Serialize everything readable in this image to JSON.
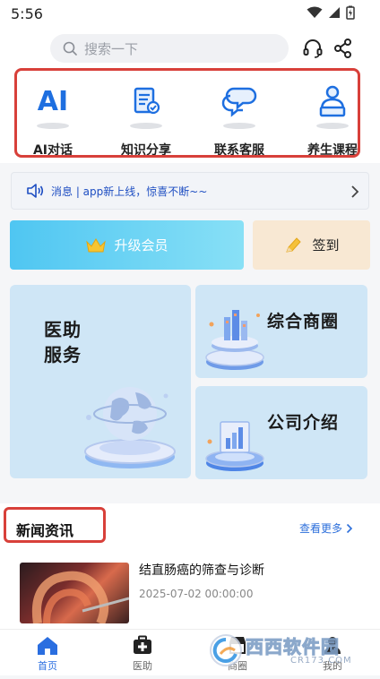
{
  "status_bar": {
    "time": "5:56"
  },
  "search": {
    "placeholder": "搜索一下"
  },
  "quick_actions": [
    {
      "label": "AI对话",
      "icon": "ai-icon",
      "icon_text": "AI"
    },
    {
      "label": "知识分享",
      "icon": "document-icon"
    },
    {
      "label": "联系客服",
      "icon": "chat-bubbles-icon"
    },
    {
      "label": "养生课程",
      "icon": "person-laptop-icon"
    }
  ],
  "notice": {
    "text": "消息 | app新上线，惊喜不断~~"
  },
  "vip": {
    "label": "升级会员"
  },
  "signin": {
    "label": "签到"
  },
  "cards": {
    "medical": {
      "line1": "医助",
      "line2": "服务"
    },
    "business": {
      "title": "综合商圈"
    },
    "company": {
      "title": "公司介绍"
    }
  },
  "news": {
    "section_title": "新闻资讯",
    "more_label": "查看更多",
    "items": [
      {
        "headline": "结直肠癌的筛查与诊断",
        "date": "2025-07-02 00:00:00"
      }
    ]
  },
  "tabs": [
    {
      "label": "首页",
      "icon": "home-icon",
      "active": true
    },
    {
      "label": "医助",
      "icon": "medical-kit-icon",
      "active": false
    },
    {
      "label": "商圈",
      "icon": "shop-icon",
      "active": false
    },
    {
      "label": "我的",
      "icon": "user-icon",
      "active": false
    }
  ],
  "watermark": {
    "text": "西西软件园",
    "sub": "CR173.COM"
  },
  "colors": {
    "accent": "#2a6ee0",
    "highlight_border": "#d8403a",
    "card_bg": "#cfe6f6"
  }
}
